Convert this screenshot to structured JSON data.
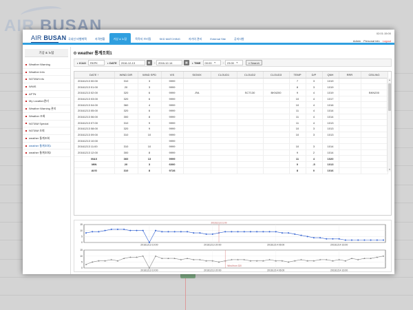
{
  "app": {
    "brand": {
      "air": "AIR",
      "busan": "BUSAN"
    },
    "clock": "02:01:15:00",
    "user_menu": {
      "admin": "Admin",
      "personal_info": "Personal info",
      "logout": "Logout"
    }
  },
  "nav": [
    {
      "label": "국내선 비행계획",
      "active": false
    },
    {
      "label": "자격현황",
      "active": false
    },
    {
      "label": "기상 & 노탐",
      "active": true
    },
    {
      "label": "목적지 브리핑",
      "active": false
    },
    {
      "label": "SKD MATCHING",
      "active": false
    },
    {
      "label": "자가의 관리",
      "active": false
    },
    {
      "label": "External Site",
      "active": false
    },
    {
      "label": "공지사항",
      "active": false
    }
  ],
  "sidebar": {
    "title": "기상 & 노탐",
    "items": [
      {
        "label": "Weather Warning",
        "active": false
      },
      {
        "label": "Weather Info",
        "active": false
      },
      {
        "label": "NOTAM Info",
        "active": false
      },
      {
        "label": "WNIS",
        "active": false
      },
      {
        "label": "AFTN",
        "active": false
      },
      {
        "label": "My Location관리",
        "active": false
      },
      {
        "label": "Weather Warning 관리",
        "active": false
      },
      {
        "label": "Weather 조회",
        "active": false
      },
      {
        "label": "NOTAM Special",
        "active": false
      },
      {
        "label": "NOTAM 조회",
        "active": false
      },
      {
        "label": "weather 통계조회",
        "active": false
      },
      {
        "label": "weather 통계조회1",
        "active": true
      },
      {
        "label": "weather 통계조회2",
        "active": false
      }
    ]
  },
  "page": {
    "title": "weather 통계조회1"
  },
  "filters": {
    "icao_label": "ICAO",
    "icao_value": "RKPK",
    "date_label": "DATE",
    "date_from": "2016-12-13",
    "date_to": "2016-12-14",
    "date_sep": "~",
    "time_label": "TIME",
    "time_from": "00:00",
    "time_to": "23:00",
    "search_label": "Search"
  },
  "table": {
    "columns": [
      "DATE ↑",
      "WIND DIR",
      "WIND SPD",
      "VIS",
      "SIGWX",
      "CLOUD1",
      "CLOUD2",
      "CLOUD3",
      "TEMP",
      "D/P",
      "QNH",
      "RRR",
      "CEILING"
    ],
    "rows": [
      [
        "20161213 00:00",
        "310",
        "3",
        "9999",
        "",
        "",
        "",
        "",
        "7",
        "3",
        "1019",
        "",
        ""
      ],
      [
        "20161213 01:00",
        "20",
        "3",
        "9999",
        "",
        "",
        "",
        "",
        "8",
        "3",
        "1019",
        "",
        ""
      ],
      [
        "20161213 02:00",
        "320",
        "6",
        "9999",
        "-RA",
        "",
        "SCT130",
        "BKN200",
        "9",
        "4",
        "1019",
        "",
        "BKN200"
      ],
      [
        "20161213 03:00",
        "320",
        "6",
        "9999",
        "",
        "",
        "",
        "",
        "10",
        "4",
        "1017",
        "",
        ""
      ],
      [
        "20161213 04:00",
        "360",
        "4",
        "9999",
        "",
        "",
        "",
        "",
        "10",
        "4",
        "1016",
        "",
        ""
      ],
      [
        "20161213 05:00",
        "320",
        "6",
        "9999",
        "",
        "",
        "",
        "",
        "11",
        "4",
        "1014",
        "",
        ""
      ],
      [
        "20161213 06:00",
        "300",
        "8",
        "9999",
        "",
        "",
        "",
        "",
        "11",
        "4",
        "1014",
        "",
        ""
      ],
      [
        "20161213 07:00",
        "310",
        "9",
        "9999",
        "",
        "",
        "",
        "",
        "11",
        "4",
        "1013",
        "",
        ""
      ],
      [
        "20161213 08:00",
        "320",
        "9",
        "9999",
        "",
        "",
        "",
        "",
        "10",
        "3",
        "1013",
        "",
        ""
      ],
      [
        "20161213 09:00",
        "310",
        "10",
        "9999",
        "",
        "",
        "",
        "",
        "10",
        "3",
        "1013",
        "",
        ""
      ],
      [
        "20161213 10:00",
        "",
        "",
        "9999",
        "",
        "",
        "",
        "",
        "",
        "",
        "",
        "",
        ""
      ],
      [
        "20161213 11:00",
        "310",
        "10",
        "9999",
        "",
        "",
        "",
        "",
        "10",
        "3",
        "1014",
        "",
        ""
      ],
      [
        "20161213 12:00",
        "300",
        "8",
        "9999",
        "",
        "",
        "",
        "",
        "9",
        "2",
        "1014",
        "",
        ""
      ]
    ],
    "summary": [
      [
        "MAX",
        "360",
        "13",
        "9999",
        "",
        "",
        "",
        "",
        "11",
        "4",
        "1020",
        "",
        ""
      ],
      [
        "MIN",
        "20",
        "3",
        "6000",
        "",
        "",
        "",
        "",
        "0",
        "-5",
        "1013",
        "",
        ""
      ],
      [
        "AVG",
        "310",
        "8",
        "9728",
        "",
        "",
        "",
        "",
        "8",
        "0",
        "1016",
        "",
        ""
      ]
    ]
  },
  "chart_data": [
    {
      "type": "line",
      "ylim": [
        0,
        15
      ],
      "yticks": [
        "15",
        "10",
        "5",
        "0"
      ],
      "xtick_labels": [
        "20161213 10:00",
        "20161213 20:00",
        "20161214 06:00",
        "20161214 16:00"
      ],
      "xtick_index": [
        10,
        20,
        30,
        40
      ],
      "hover_label": "20161213 21:00",
      "hover_index": 21,
      "series": [
        {
          "color": "#2f5fd0",
          "values": [
            8,
            9,
            9,
            10,
            11,
            11,
            11,
            10,
            10,
            10,
            0,
            10,
            9,
            9,
            9,
            9,
            9,
            8,
            8,
            7,
            7,
            8,
            9,
            9,
            9,
            9,
            9,
            9,
            9,
            9,
            9,
            8,
            8,
            7,
            6,
            5,
            4,
            4,
            3,
            3,
            3,
            2,
            2,
            2,
            2,
            2,
            2,
            2
          ]
        }
      ]
    },
    {
      "type": "line",
      "ylim": [
        0,
        15
      ],
      "yticks": [
        "15",
        "10",
        "5",
        "0"
      ],
      "xtick_labels": [
        "20161213 10:00",
        "20161213 20:00",
        "20161214 06:00",
        "20161214 16:00"
      ],
      "xtick_index": [
        10,
        20,
        30,
        40
      ],
      "annotation": "Wind from 320",
      "annotation_index": 22,
      "series": [
        {
          "color": "#888888",
          "values": [
            3,
            5,
            6,
            6,
            7,
            6,
            8,
            9,
            9,
            10,
            0,
            10,
            8,
            8,
            8,
            7,
            8,
            7,
            7,
            6,
            6,
            5,
            6,
            7,
            7,
            7,
            6,
            6,
            6,
            7,
            6,
            6,
            5,
            6,
            7,
            6,
            6,
            7,
            7,
            6,
            7,
            6,
            8,
            7,
            8,
            8,
            9,
            10
          ]
        }
      ]
    }
  ],
  "colors": {
    "accent": "#2f9fdf",
    "brand": "#1a4a8c",
    "logout": "#dd3333"
  }
}
